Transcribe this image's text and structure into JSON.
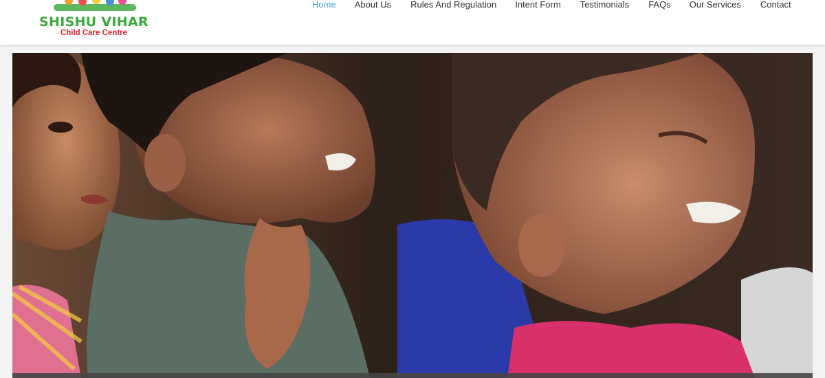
{
  "brand": {
    "name": "SHISHU VIHAR",
    "tagline": "Child Care Centre",
    "name_color": "#3aaa3a",
    "tagline_color": "#e0232a"
  },
  "nav": {
    "active_color": "#4aa3df",
    "items": [
      {
        "label": "Home",
        "active": true
      },
      {
        "label": "About Us",
        "active": false
      },
      {
        "label": "Rules And Regulation",
        "active": false
      },
      {
        "label": "Intent Form",
        "active": false
      },
      {
        "label": "Testimonials",
        "active": false
      },
      {
        "label": "FAQs",
        "active": false
      },
      {
        "label": "Our Services",
        "active": false
      },
      {
        "label": "Contact",
        "active": false
      }
    ]
  },
  "hero": {
    "image_icon": "photo-children-icon"
  }
}
